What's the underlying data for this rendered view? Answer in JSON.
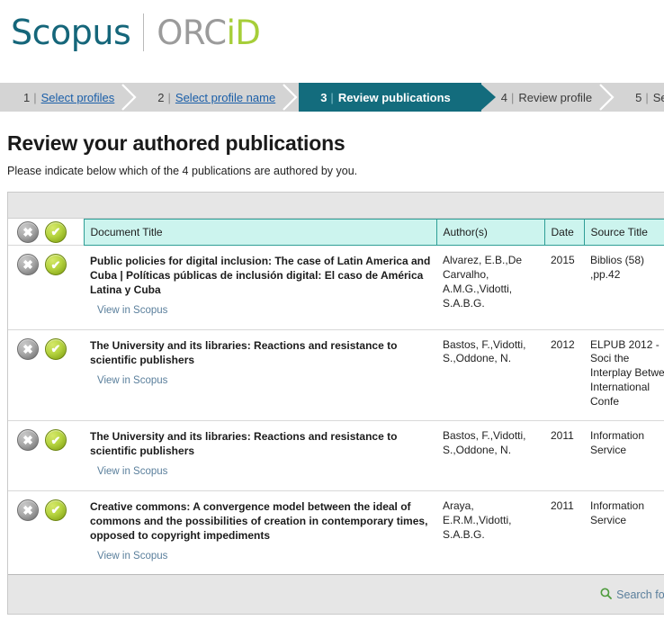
{
  "brand": {
    "scopus": "Scopus",
    "orcid_prefix": "ORC",
    "orcid_id": "iD",
    "colors": {
      "scopus_teal": "#15667a",
      "orcid_gray": "#9b9b9b",
      "orcid_green": "#a6ce39",
      "step_active": "#136c7d",
      "header_cyan": "#ccf4ee",
      "link_blue": "#1a5ea8",
      "view_link": "#5a7f9c"
    }
  },
  "steps": [
    {
      "num": "1",
      "sep": "|",
      "label": "Select profiles",
      "is_link": true,
      "active": false
    },
    {
      "num": "2",
      "sep": "|",
      "label": "Select profile name",
      "is_link": true,
      "active": false
    },
    {
      "num": "3",
      "sep": "|",
      "label": "Review publications",
      "is_link": false,
      "active": true
    },
    {
      "num": "4",
      "sep": "|",
      "label": "Review profile",
      "is_link": false,
      "active": false
    },
    {
      "num": "5",
      "sep": "|",
      "label": "Send Auth",
      "is_link": false,
      "active": false
    }
  ],
  "page": {
    "title": "Review your authored publications",
    "subtitle": "Please indicate below which of the 4 publications are authored by you."
  },
  "table": {
    "columns": {
      "actions": "",
      "title": "Document Title",
      "authors": "Author(s)",
      "date": "Date",
      "source": "Source Title"
    },
    "header_icons": {
      "reject": "reject-all-icon",
      "accept": "accept-all-icon"
    },
    "rows": [
      {
        "title": "Public policies for digital inclusion: The case of Latin America and Cuba | Políticas públicas de inclusión digital: El caso de América Latina y Cuba",
        "view_link": "View in Scopus",
        "authors": "Alvarez, E.B.,De Carvalho, A.M.G.,Vidotti, S.A.B.G.",
        "date": "2015",
        "source": "Biblios (58) ,pp.42"
      },
      {
        "title": "The University and its libraries: Reactions and resistance to scientific publishers",
        "view_link": "View in Scopus",
        "authors": "Bastos, F.,Vidotti, S.,Oddone, N.",
        "date": "2012",
        "source": "ELPUB 2012 - Soci the Interplay Betwe International Confe"
      },
      {
        "title": "The University and its libraries: Reactions and resistance to scientific publishers",
        "view_link": "View in Scopus",
        "authors": "Bastos, F.,Vidotti, S.,Oddone, N.",
        "date": "2011",
        "source": "Information Service"
      },
      {
        "title": "Creative commons: A convergence model between the ideal of commons and the possibilities of creation in contemporary times, opposed to copyright impediments",
        "view_link": "View in Scopus",
        "authors": "Araya, E.R.M.,Vidotti, S.A.B.G.",
        "date": "2011",
        "source": "Information Service"
      }
    ]
  },
  "footer": {
    "search_missing": "Search for miss",
    "search_icon": "magnifier-icon"
  }
}
